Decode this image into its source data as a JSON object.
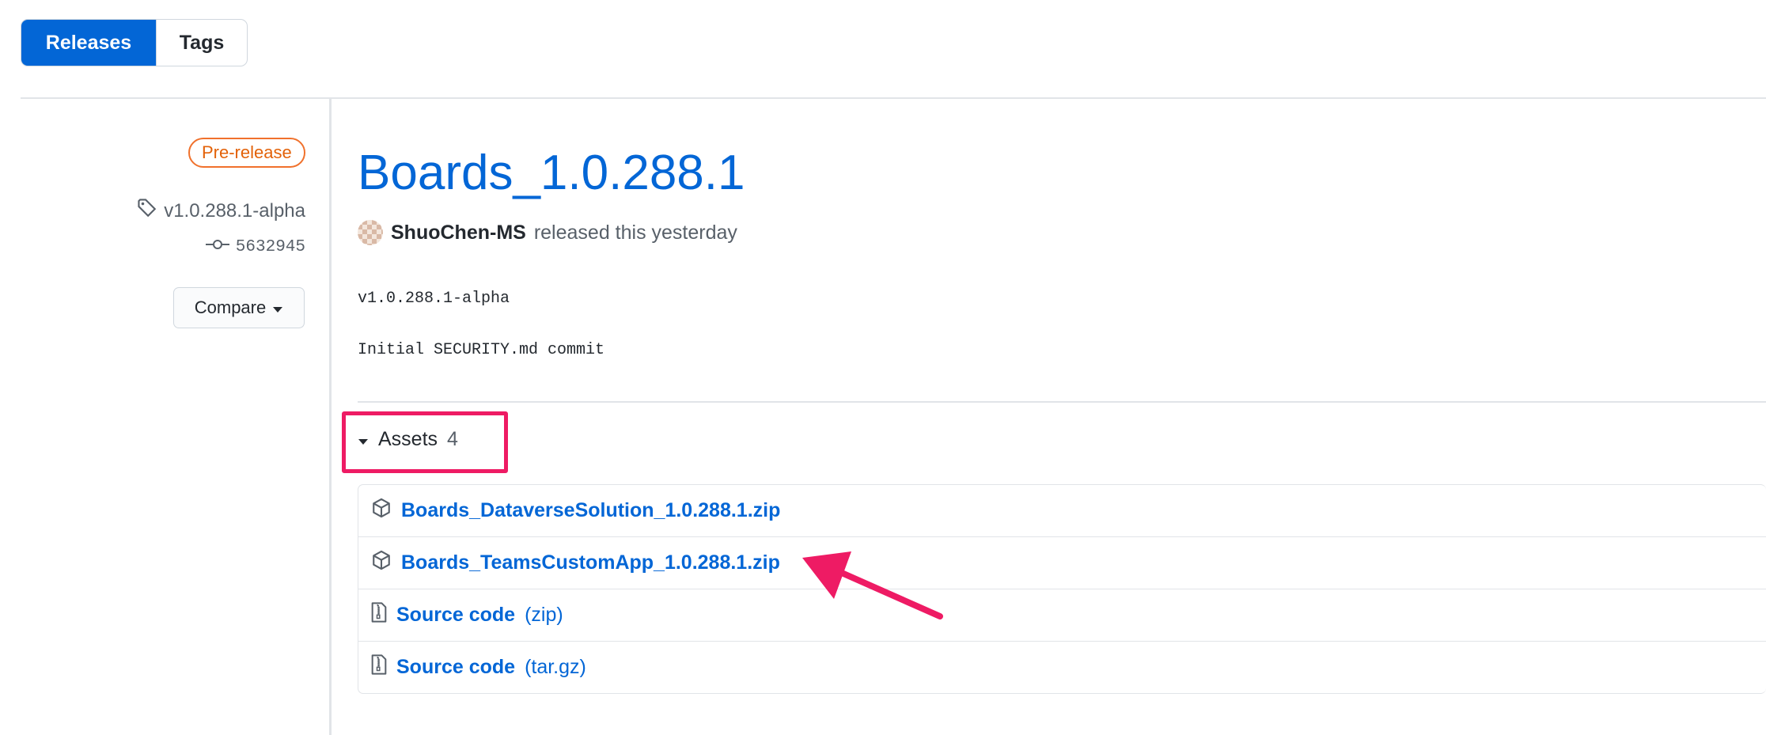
{
  "tabs": {
    "releases": "Releases",
    "tags": "Tags"
  },
  "sidebar": {
    "badge": "Pre-release",
    "tag": "v1.0.288.1-alpha",
    "commit": "5632945",
    "compare": "Compare"
  },
  "release": {
    "title": "Boards_1.0.288.1",
    "author": "ShuoChen-MS",
    "released_text": "released this yesterday",
    "body_line1": "v1.0.288.1-alpha",
    "body_line2": "Initial SECURITY.md commit"
  },
  "assets": {
    "label": "Assets",
    "count": "4",
    "items": [
      {
        "name": "Boards_DataverseSolution_1.0.288.1.zip",
        "suffix": "",
        "icon": "package-icon"
      },
      {
        "name": "Boards_TeamsCustomApp_1.0.288.1.zip",
        "suffix": "",
        "icon": "package-icon"
      },
      {
        "name": "Source code",
        "suffix": "(zip)",
        "icon": "file-zip-icon"
      },
      {
        "name": "Source code",
        "suffix": "(tar.gz)",
        "icon": "file-zip-icon"
      }
    ]
  },
  "colors": {
    "accent": "#0366d6",
    "prerelease": "#e36209",
    "annotation": "#ee1b64"
  }
}
